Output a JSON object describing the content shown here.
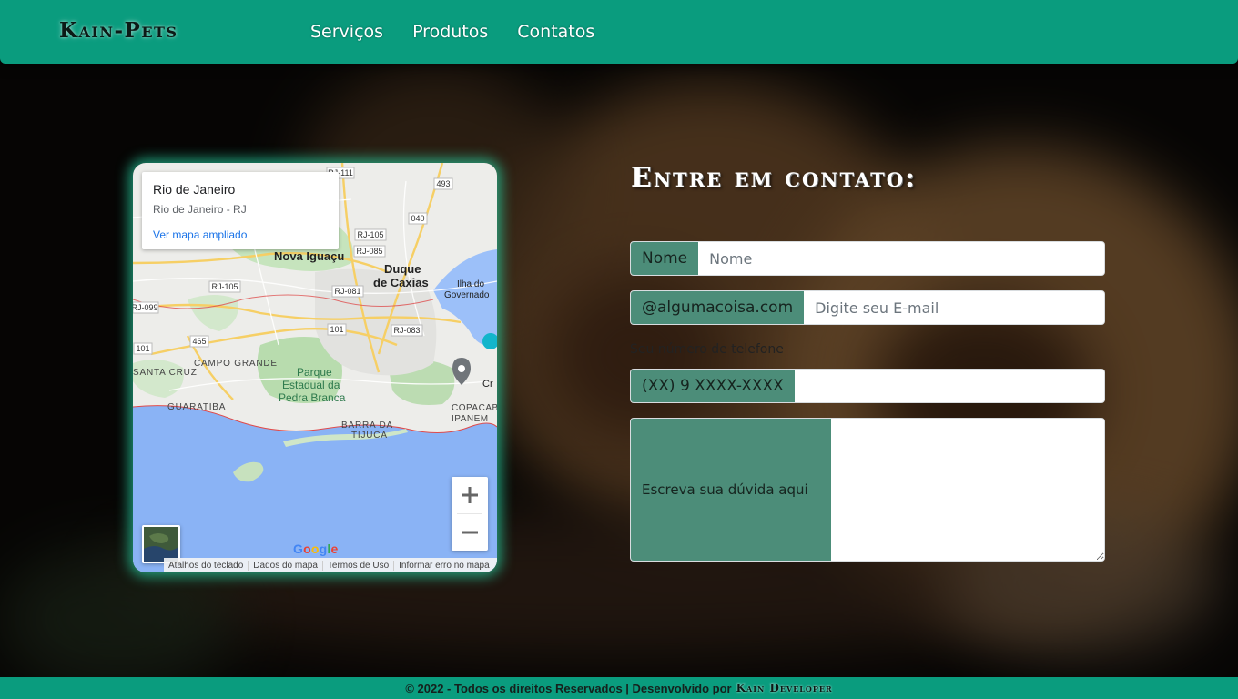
{
  "header": {
    "brand": "Kain-Pets",
    "nav": [
      "Serviços",
      "Produtos",
      "Contatos"
    ]
  },
  "map": {
    "place_title": "Rio de Janeiro",
    "place_subtitle": "Rio de Janeiro - RJ",
    "enlarge_link": "Ver mapa ampliado",
    "zoom_in_icon": "plus-icon",
    "zoom_out_icon": "minus-icon",
    "google_logo": [
      "G",
      "o",
      "o",
      "g",
      "l",
      "e"
    ],
    "labels": [
      "Nova Iguaçu",
      "Duque",
      "de Caxias",
      "Ilha do",
      "Governado",
      "CAMPO GRANDE",
      "SANTA CRUZ",
      "Parque",
      "Estadual da",
      "Pedra Branca",
      "GUARATIBA",
      "BARRA DA",
      "TIJUCA",
      "COPACAB",
      "IPANEM",
      "Cr"
    ],
    "road_shields": [
      "RJ-111",
      "493",
      "040",
      "RJ-105",
      "RJ-085",
      "RJ-105",
      "RJ-081",
      "RJ-099",
      "101",
      "RJ-083",
      "465",
      "101"
    ],
    "attribution": [
      "Atalhos do teclado",
      "Dados do mapa",
      "Termos de Uso",
      "Informar erro no mapa"
    ]
  },
  "contact": {
    "title": "Entre em contato:",
    "name_addon": "Nome",
    "name_placeholder": "Nome",
    "email_addon": "@algumacoisa.com",
    "email_placeholder": "Digite seu E-mail",
    "phone_label": "Seu número de telefone",
    "phone_addon": "(XX) 9 XXXX-XXXX",
    "phone_value": "",
    "message_addon": "Escreva sua dúvida aqui"
  },
  "footer": {
    "copyright": "© 2022 - Todos os direitos Reservados | Desenvolvido por",
    "developer": "Kain Developer"
  },
  "colors": {
    "header": "#0a9c7e",
    "addon": "#4c8d79",
    "map_glow": "#28dcaa",
    "link": "#1a73e8"
  }
}
